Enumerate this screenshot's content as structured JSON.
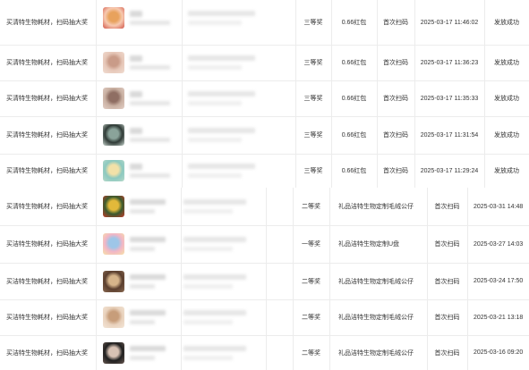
{
  "top_table": {
    "rows": [
      {
        "activity": "买清特生物耗材，扫码抽大奖",
        "prize_level": "三等奖",
        "prize": "0.66红包",
        "scan_type": "首次扫码",
        "time": "2025-03-17 11:46:02",
        "status": "发放成功",
        "avatar_colors": [
          "#f7c9b0",
          "#e8a25d",
          "#d2574a"
        ]
      },
      {
        "activity": "买清特生物耗材，扫码抽大奖",
        "prize_level": "三等奖",
        "prize": "0.66红包",
        "scan_type": "首次扫码",
        "time": "2025-03-17 11:36:23",
        "status": "发放成功",
        "avatar_colors": [
          "#e6c7b8",
          "#c99b88",
          "#f1ddd2"
        ]
      },
      {
        "activity": "买清特生物耗材，扫码抽大奖",
        "prize_level": "三等奖",
        "prize": "0.66红包",
        "scan_type": "首次扫码",
        "time": "2025-03-17 11:35:33",
        "status": "发放成功",
        "avatar_colors": [
          "#c9b0a2",
          "#8f6e63",
          "#e3cfc6"
        ]
      },
      {
        "activity": "买清特生物耗材，扫码抽大奖",
        "prize_level": "三等奖",
        "prize": "0.66红包",
        "scan_type": "首次扫码",
        "time": "2025-03-17 11:31:54",
        "status": "发放成功",
        "avatar_colors": [
          "#2f3a36",
          "#8aa39a",
          "#c9d6cf"
        ]
      },
      {
        "activity": "买清特生物耗材，扫码抽大奖",
        "prize_level": "三等奖",
        "prize": "0.66红包",
        "scan_type": "首次扫码",
        "time": "2025-03-17 11:29:24",
        "status": "发放成功",
        "avatar_colors": [
          "#8cc9c0",
          "#f2e1a8",
          "#b7d9c9"
        ]
      }
    ]
  },
  "bottom_table": {
    "rows": [
      {
        "activity": "买清特生物耗材，扫码抽大奖",
        "prize_level": "二等奖",
        "prize": "礼品洁特生物定制毛绒公仔",
        "scan_type": "首次扫码",
        "time": "2025-03-31 14:48",
        "avatar_colors": [
          "#3a5a2e",
          "#e2b93a",
          "#c23b2a"
        ]
      },
      {
        "activity": "买洁特生物耗材，扫码抽大奖",
        "prize_level": "一等奖",
        "prize": "礼品洁特生物定制U盘",
        "scan_type": "首次扫码",
        "time": "2025-03-27 14:03",
        "avatar_colors": [
          "#f2b6c6",
          "#9ec6e8",
          "#f7e2a8"
        ]
      },
      {
        "activity": "买洁特生物耗材，扫码抽大奖",
        "prize_level": "二等奖",
        "prize": "礼品洁特生物定制毛绒公仔",
        "scan_type": "首次扫码",
        "time": "2025-03-24 17:50",
        "avatar_colors": [
          "#5a3e2e",
          "#d6b48a",
          "#8a6a52"
        ]
      },
      {
        "activity": "买洁特生物耗材，扫码抽大奖",
        "prize_level": "二等奖",
        "prize": "礼品洁特生物定制毛绒公仔",
        "scan_type": "首次扫码",
        "time": "2025-03-21 13:18",
        "avatar_colors": [
          "#e9d2bd",
          "#c79d7a",
          "#f3e6d8"
        ]
      },
      {
        "activity": "买洁特生物耗材，扫码抽大奖",
        "prize_level": "二等奖",
        "prize": "礼品洁特生物定制毛绒公仔",
        "scan_type": "首次扫码",
        "time": "2025-03-16 09:20",
        "avatar_colors": [
          "#1f1f1f",
          "#d8c2b4",
          "#6a5a52"
        ]
      }
    ]
  }
}
